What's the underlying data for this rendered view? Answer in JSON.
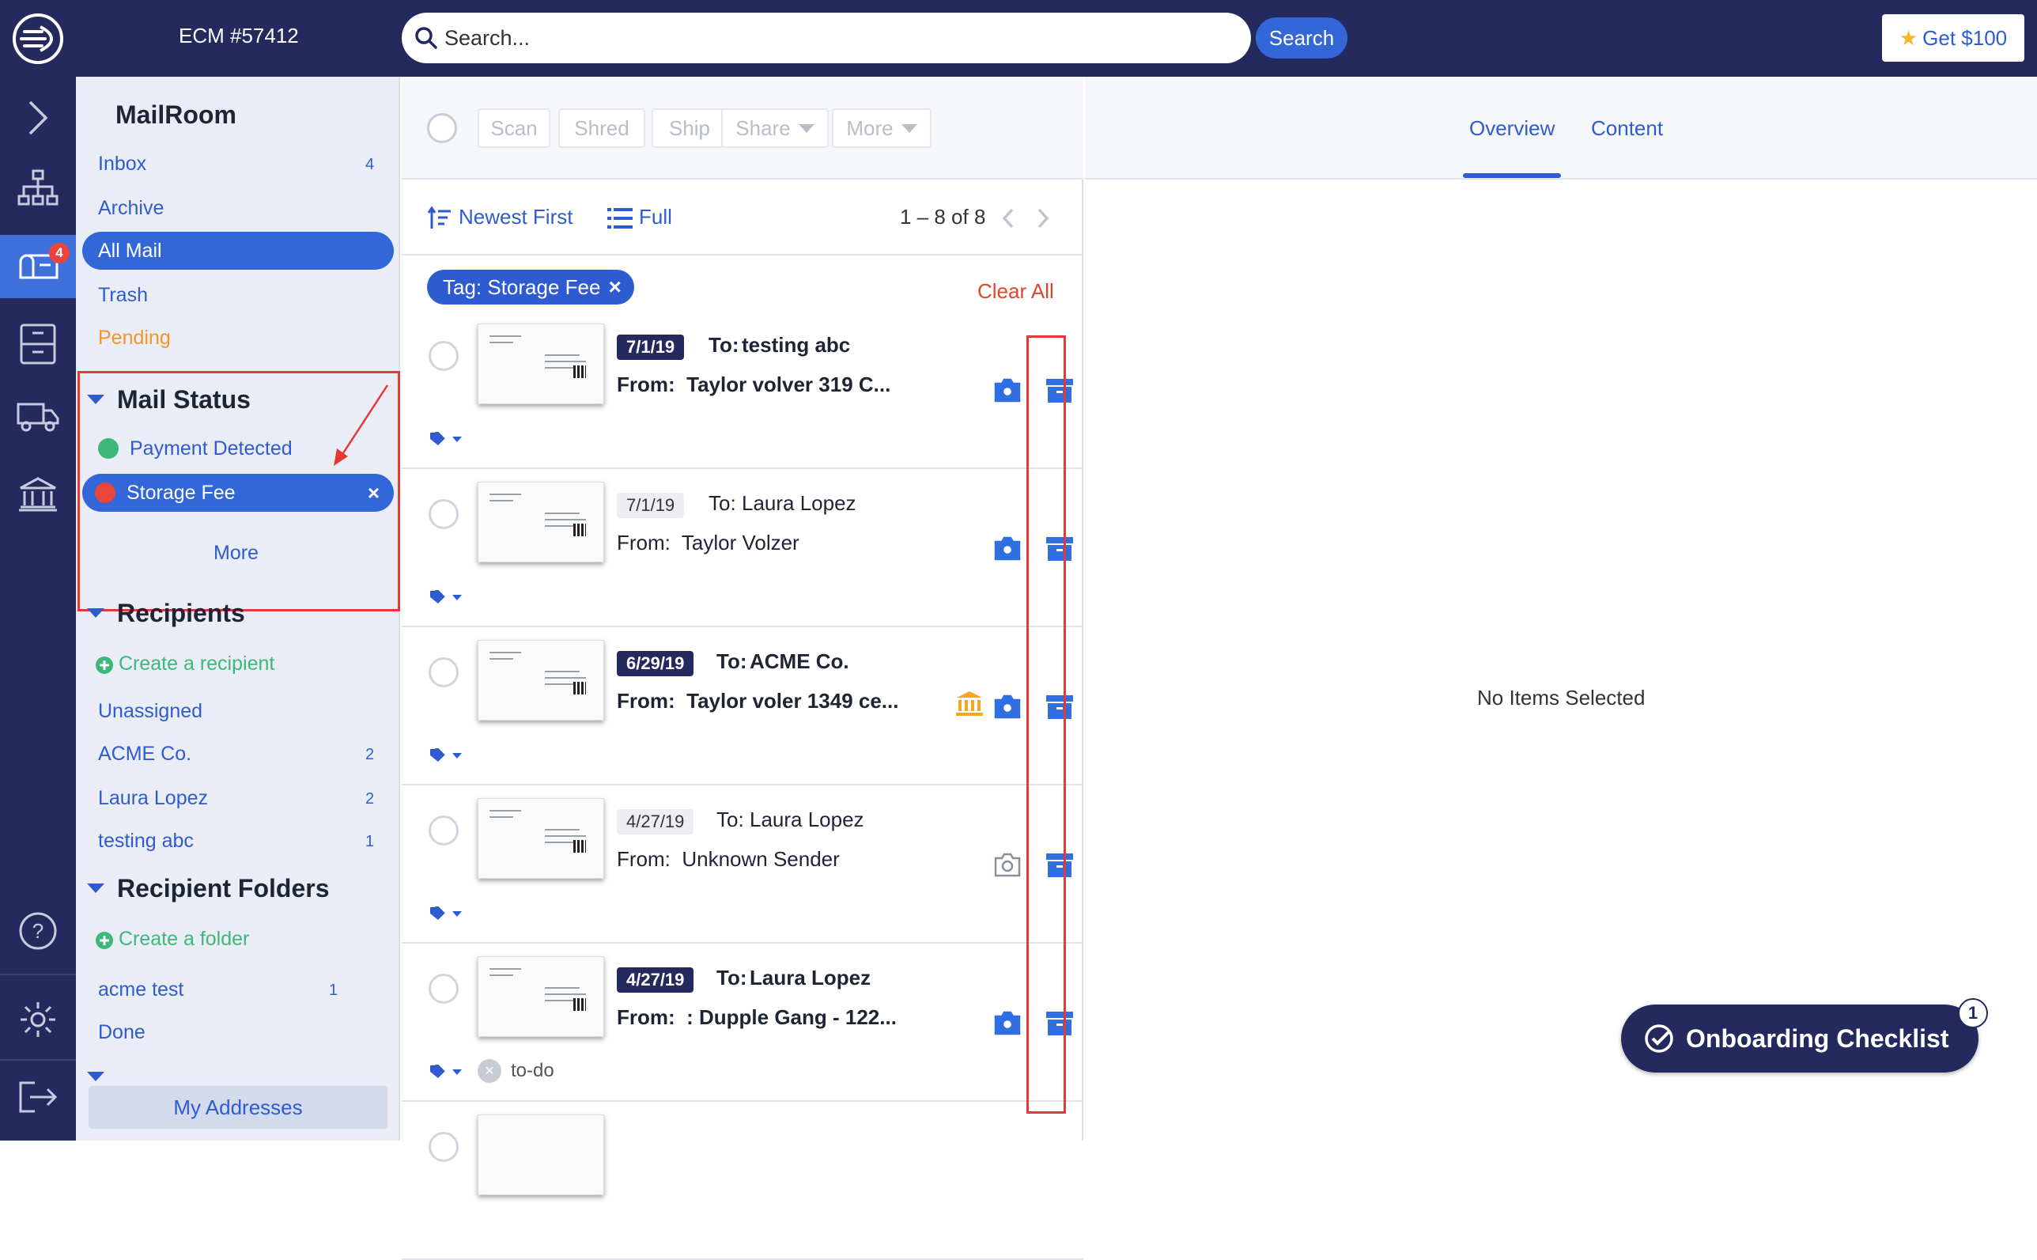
{
  "header": {
    "account": "ECM #57412",
    "search_placeholder": "Search...",
    "search_button": "Search",
    "promo_label": "Get $100"
  },
  "rail": {
    "icons": [
      "expand-icon",
      "organization-icon",
      "mailbox-icon",
      "cabinet-icon",
      "truck-icon",
      "bank-icon",
      "help-icon",
      "settings-icon",
      "logout-icon"
    ],
    "mailbox_badge": "4"
  },
  "sidebar": {
    "title": "MailRoom",
    "folders": [
      {
        "label": "Inbox",
        "count": "4"
      },
      {
        "label": "Archive",
        "count": ""
      },
      {
        "label": "All Mail",
        "count": ""
      },
      {
        "label": "Trash",
        "count": ""
      },
      {
        "label": "Pending",
        "count": ""
      }
    ],
    "mail_status": {
      "title": "Mail Status",
      "items": [
        {
          "label": "Payment Detected",
          "color": "#3cb878"
        },
        {
          "label": "Storage Fee",
          "color": "#e8453c"
        }
      ],
      "more": "More"
    },
    "recipients": {
      "title": "Recipients",
      "create": "Create a recipient",
      "items": [
        {
          "label": "Unassigned",
          "count": ""
        },
        {
          "label": "ACME Co.",
          "count": "2"
        },
        {
          "label": "Laura Lopez",
          "count": "2"
        },
        {
          "label": "testing abc",
          "count": "1"
        }
      ]
    },
    "recipient_folders": {
      "title": "Recipient Folders",
      "create": "Create a folder",
      "items": [
        {
          "label": "acme test",
          "count": "1"
        },
        {
          "label": "Done",
          "count": ""
        }
      ]
    },
    "my_addresses": "My Addresses"
  },
  "toolbar": {
    "actions": [
      "Scan",
      "Shred",
      "Ship",
      "Share",
      "More"
    ]
  },
  "list": {
    "sort": "Newest First",
    "view": "Full",
    "range": "1 – 8 of 8",
    "filter_tag": "Tag: Storage Fee",
    "clear_all": "Clear All",
    "items": [
      {
        "date": "7/1/19",
        "to_label": "To:",
        "to": "testing abc",
        "from_label": "From:",
        "from": "Taylor volver 319 C...",
        "unread": true,
        "scanned": true,
        "payment": false,
        "tag": ""
      },
      {
        "date": "7/1/19",
        "to_label": "To:",
        "to": "Laura Lopez",
        "from_label": "From:",
        "from": "Taylor Volzer",
        "unread": false,
        "scanned": true,
        "payment": false,
        "tag": ""
      },
      {
        "date": "6/29/19",
        "to_label": "To:",
        "to": "ACME Co.",
        "from_label": "From:",
        "from": "Taylor voler 1349 ce...",
        "unread": true,
        "scanned": true,
        "payment": true,
        "tag": ""
      },
      {
        "date": "4/27/19",
        "to_label": "To:",
        "to": "Laura Lopez",
        "from_label": "From:",
        "from": "Unknown Sender",
        "unread": false,
        "scanned": false,
        "payment": false,
        "tag": ""
      },
      {
        "date": "4/27/19",
        "to_label": "To:",
        "to": "Laura Lopez",
        "from_label": "From:",
        "from": ": Dupple Gang - 122...",
        "unread": true,
        "scanned": true,
        "payment": false,
        "tag": "to-do"
      }
    ]
  },
  "detail": {
    "tabs": [
      "Overview",
      "Content"
    ],
    "empty_text": "No Items Selected"
  },
  "onboarding": {
    "label": "Onboarding Checklist",
    "badge": "1"
  },
  "colors": {
    "nav_dark": "#24295e",
    "accent": "#3366d6",
    "annotation_red": "#e53935"
  }
}
